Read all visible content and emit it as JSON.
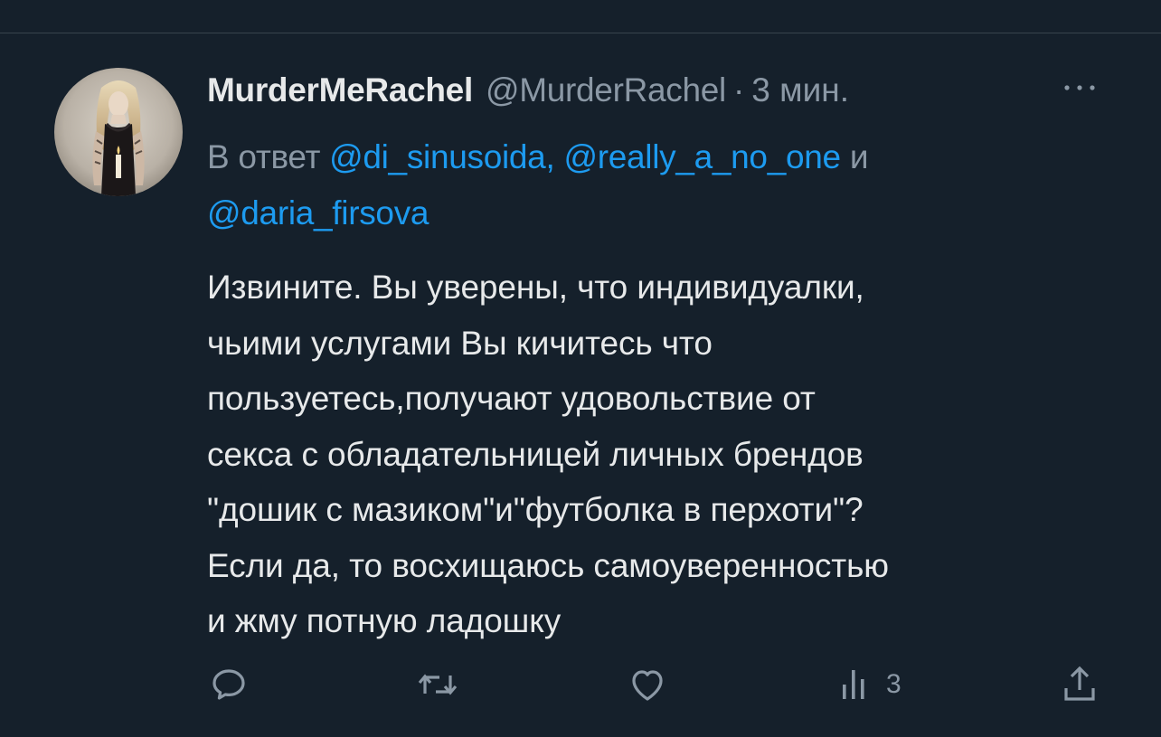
{
  "tweet": {
    "display_name": "MurderMeRachel",
    "handle": "@MurderRachel",
    "separator": "·",
    "time": "3 мин.",
    "reply_prefix": "В ответ",
    "mention_1": "@di_sinusoida,",
    "mention_2": "@really_a_no_one",
    "reply_and": "и",
    "mention_3": "@daria_firsova",
    "body_lines": [
      "Извините. Вы уверены, что индивидуалки,",
      "чьими услугами Вы кичитесь что",
      "пользуетесь,получают удовольствие от",
      "секса с обладательницей личных брендов",
      "\"дошик с мазиком\"и\"футболка в перхоти\"?",
      "Если да, то восхищаюсь самоуверенностью",
      "и жму потную ладошку"
    ],
    "views_count": "3"
  },
  "icons": {
    "more": "more-dots-icon",
    "reply": "reply-bubble-icon",
    "retweet": "retweet-icon",
    "like": "heart-icon",
    "views": "views-bars-icon",
    "share": "share-icon"
  },
  "colors": {
    "background": "#15202b",
    "accent": "#1d9bf0",
    "text_primary": "#e7e9ea",
    "text_secondary": "#8b98a5"
  }
}
